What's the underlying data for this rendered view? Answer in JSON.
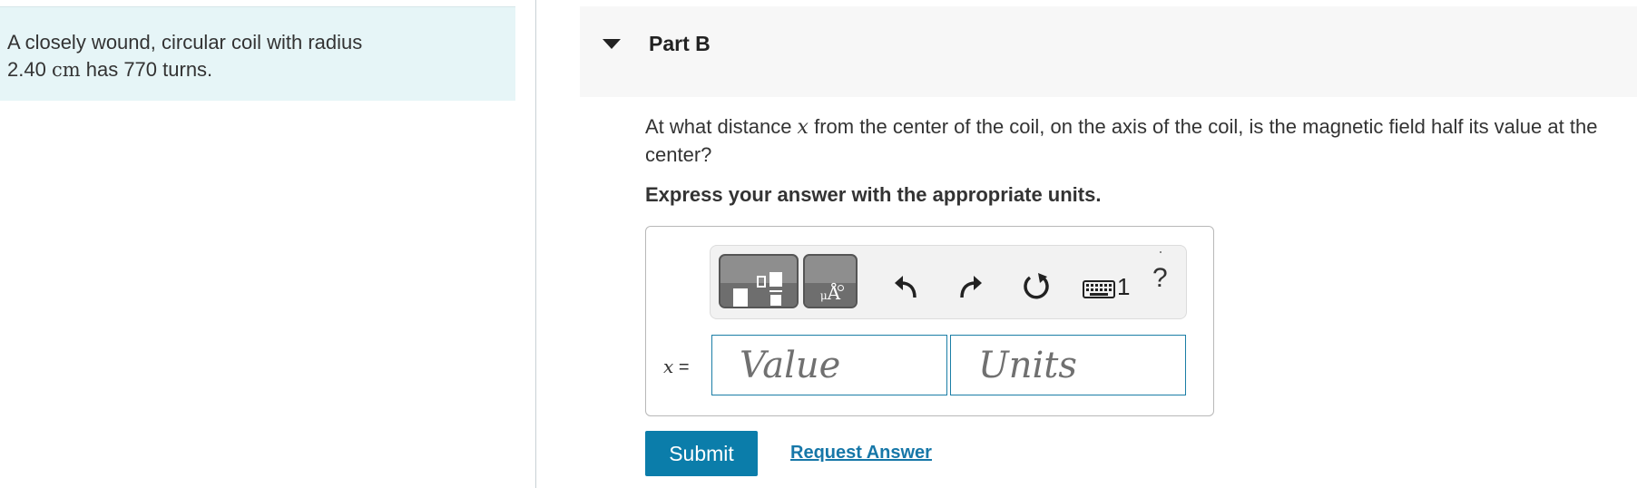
{
  "problem": {
    "text_before_unit": "A closely wound, circular coil with radius 2.40 ",
    "unit": "cm",
    "text_after_unit": " has 770 turns."
  },
  "part": {
    "title": "Part B",
    "question_before_var": "At what distance ",
    "variable": "x",
    "question_after_var": " from the center of the coil, on the axis of the coil, is the magnetic field half its value at the center?",
    "instruction": "Express your answer with the appropriate units."
  },
  "toolbar": {
    "units_glyph": "Å",
    "units_sub": "μ",
    "keyboard_suffix": "1",
    "help_label": "?",
    "icons": [
      "templates-icon",
      "units-icon",
      "undo-icon",
      "redo-icon",
      "reset-icon",
      "keyboard-icon",
      "help-icon"
    ]
  },
  "answer": {
    "label": "x =",
    "value_placeholder": "Value",
    "units_placeholder": "Units"
  },
  "actions": {
    "submit_label": "Submit",
    "request_label": "Request Answer"
  },
  "colors": {
    "problem_bg": "#e6f5f7",
    "header_bg": "#f7f7f7",
    "accent": "#0b7daa",
    "link": "#1677a8"
  }
}
